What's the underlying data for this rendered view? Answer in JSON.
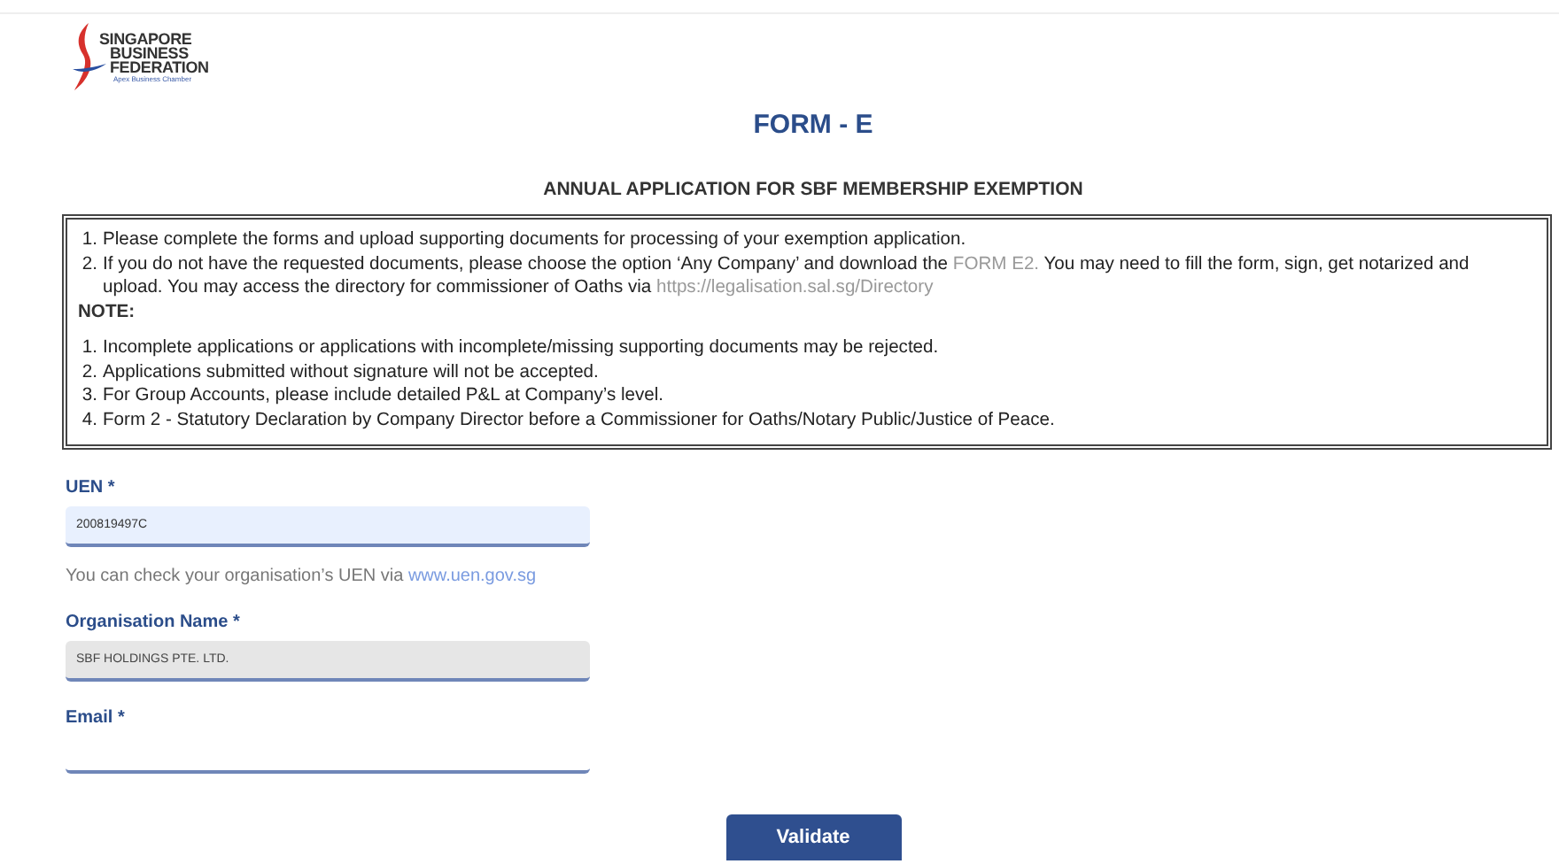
{
  "logo": {
    "lines": [
      "SINGAPORE",
      "BUSINESS",
      "FEDERATION"
    ],
    "tagline": "Apex Business Chamber"
  },
  "title": "FORM - E",
  "subtitle": "ANNUAL APPLICATION FOR SBF MEMBERSHIP EXEMPTION",
  "instructions": [
    {
      "number": "1.",
      "parts": [
        {
          "kind": "text",
          "text": "Please complete the forms and upload supporting documents for processing of your exemption application."
        }
      ]
    },
    {
      "number": "2.",
      "parts": [
        {
          "kind": "text",
          "text": "If you do not have the requested documents, please choose the option ‘Any Company’ and download the "
        },
        {
          "kind": "link",
          "text": "FORM E2."
        },
        {
          "kind": "text",
          "text": " You may need to fill the form, sign, get notarized and upload. You may access the directory for commissioner of Oaths via "
        },
        {
          "kind": "link",
          "text": "https://legalisation.sal.sg/Directory"
        }
      ]
    }
  ],
  "note_heading": "NOTE:",
  "notes": [
    {
      "number": "1.",
      "text": "Incomplete applications or applications with incomplete/missing supporting documents may be rejected."
    },
    {
      "number": "2.",
      "text": "Applications submitted without signature will not be accepted."
    },
    {
      "number": "3.",
      "text": "For Group Accounts, please include detailed P&L at Company’s level."
    },
    {
      "number": "4.",
      "text": "Form 2 - Statutory Declaration by Company Director before a Commissioner for Oaths/Notary Public/Justice of Peace."
    }
  ],
  "fields": [
    {
      "label": "UEN *",
      "value": "200819497C",
      "kind": "filled",
      "disabled": false,
      "help": {
        "text": "You can check your organisation’s UEN via ",
        "link": "www.uen.gov.sg"
      }
    },
    {
      "label": "Organisation Name *",
      "value": "SBF HOLDINGS PTE. LTD.",
      "kind": "filled",
      "disabled": true
    },
    {
      "label": "Email *",
      "kind": "underline",
      "disabled": false
    }
  ],
  "button": "Validate"
}
